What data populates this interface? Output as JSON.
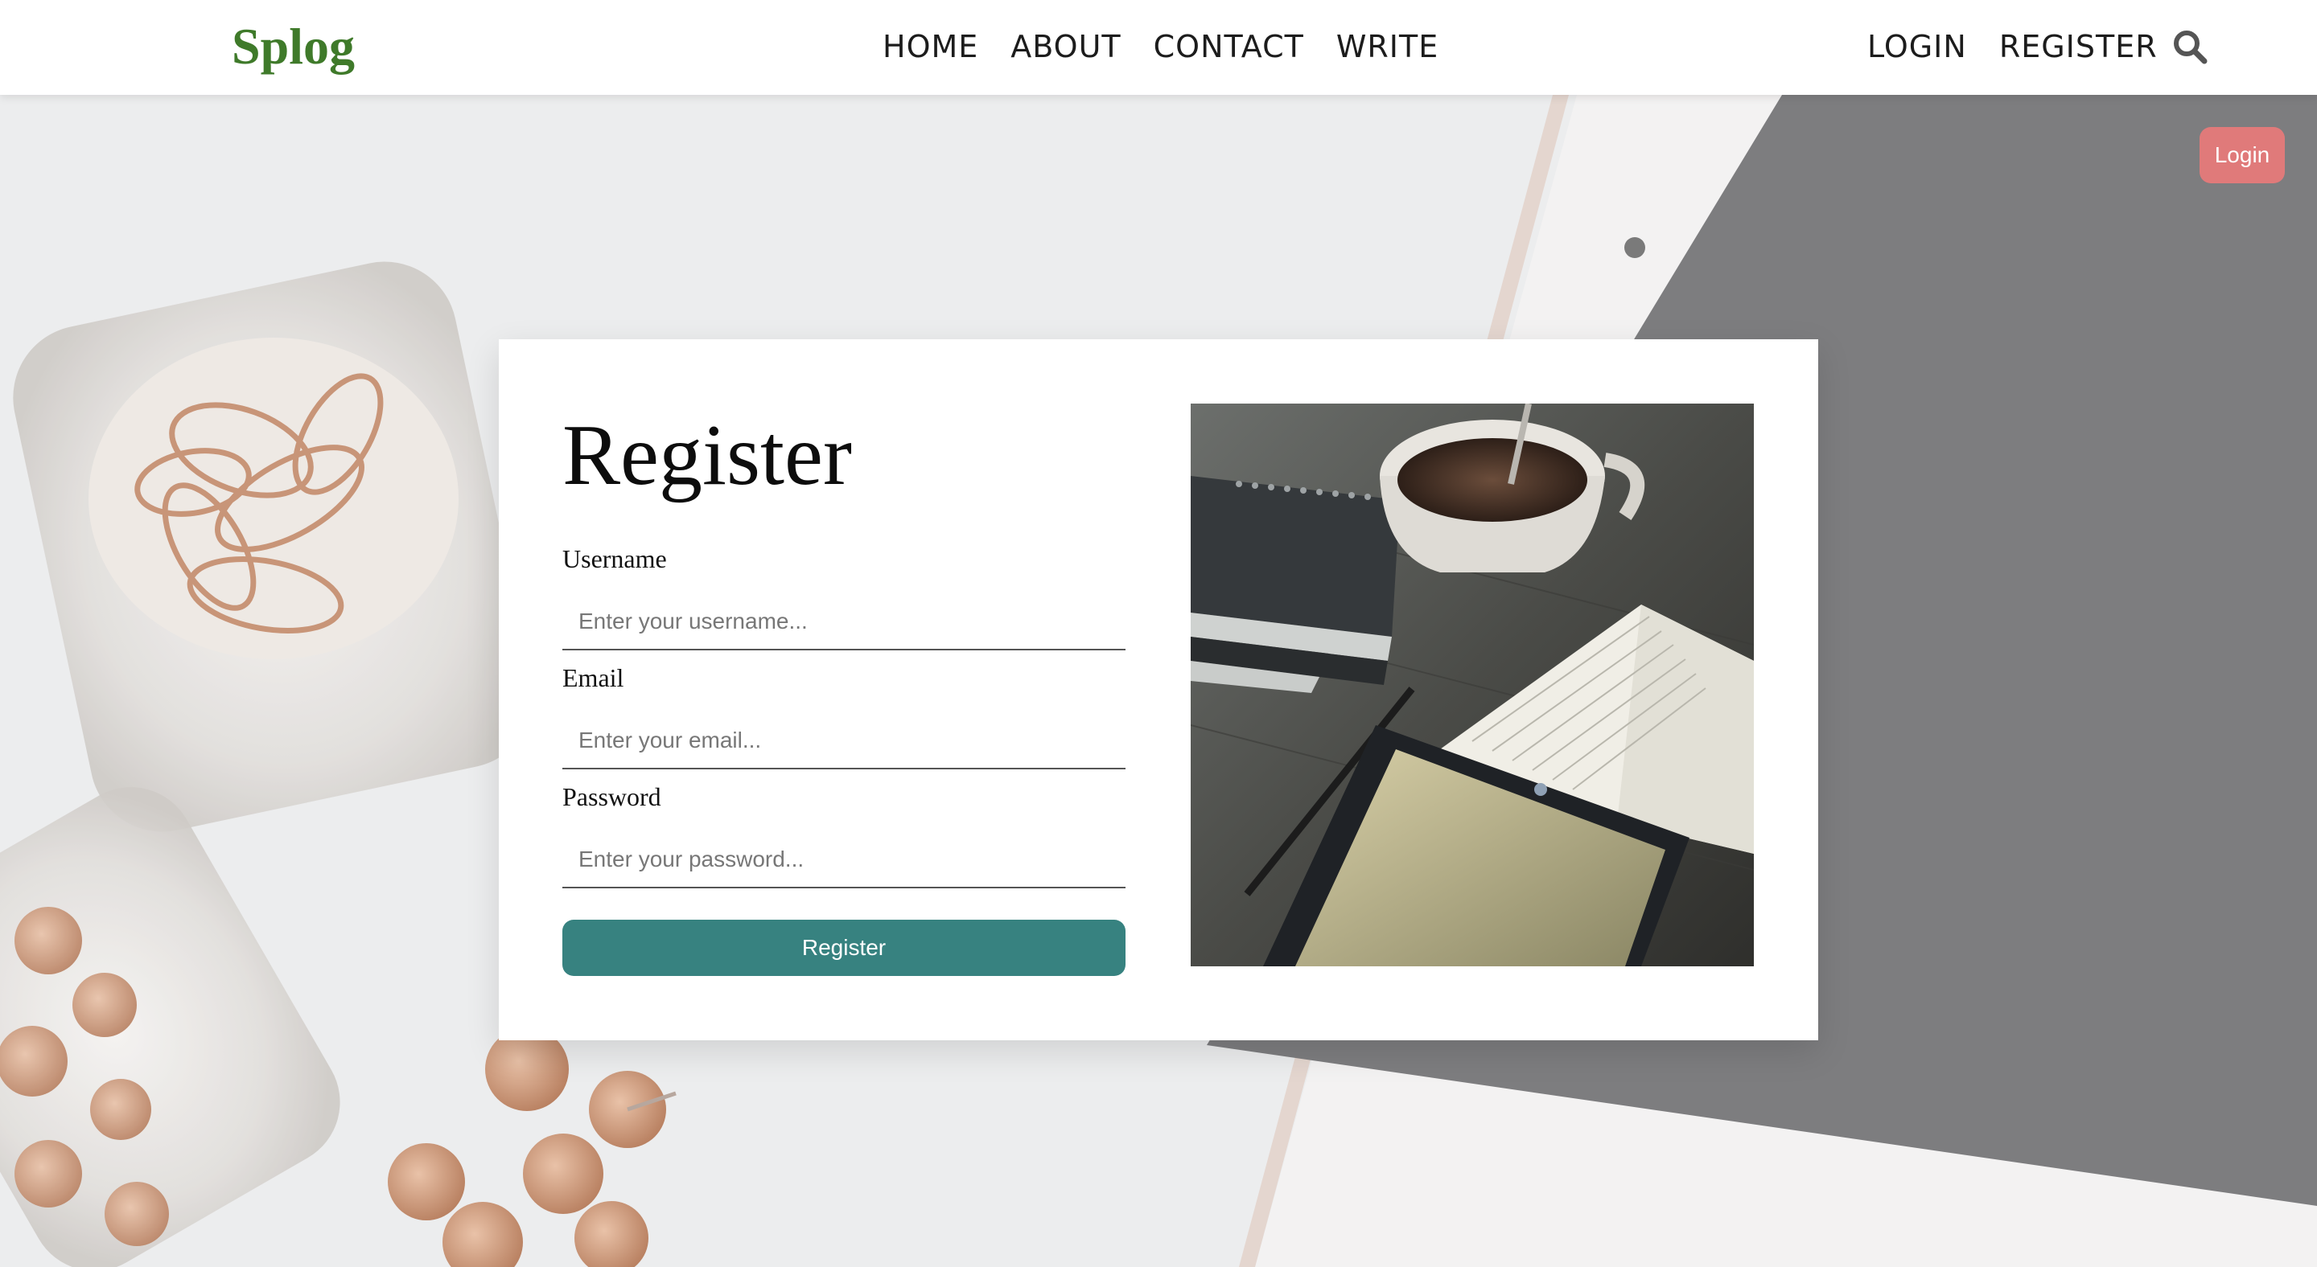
{
  "brand": {
    "name": "Splog",
    "color": "#3f7a2a"
  },
  "nav": {
    "main_links": [
      "HOME",
      "ABOUT",
      "CONTACT",
      "WRITE"
    ],
    "account_links": [
      "LOGIN",
      "REGISTER"
    ],
    "search_icon": "search-icon"
  },
  "floating_button": {
    "label": "Login",
    "color": "#e07a7a"
  },
  "form": {
    "title": "Register",
    "fields": [
      {
        "label": "Username",
        "placeholder": "Enter your username...",
        "value": ""
      },
      {
        "label": "Email",
        "placeholder": "Enter your email...",
        "value": ""
      },
      {
        "label": "Password",
        "placeholder": "Enter your password...",
        "value": ""
      }
    ],
    "submit_label": "Register",
    "submit_color": "#378280"
  }
}
